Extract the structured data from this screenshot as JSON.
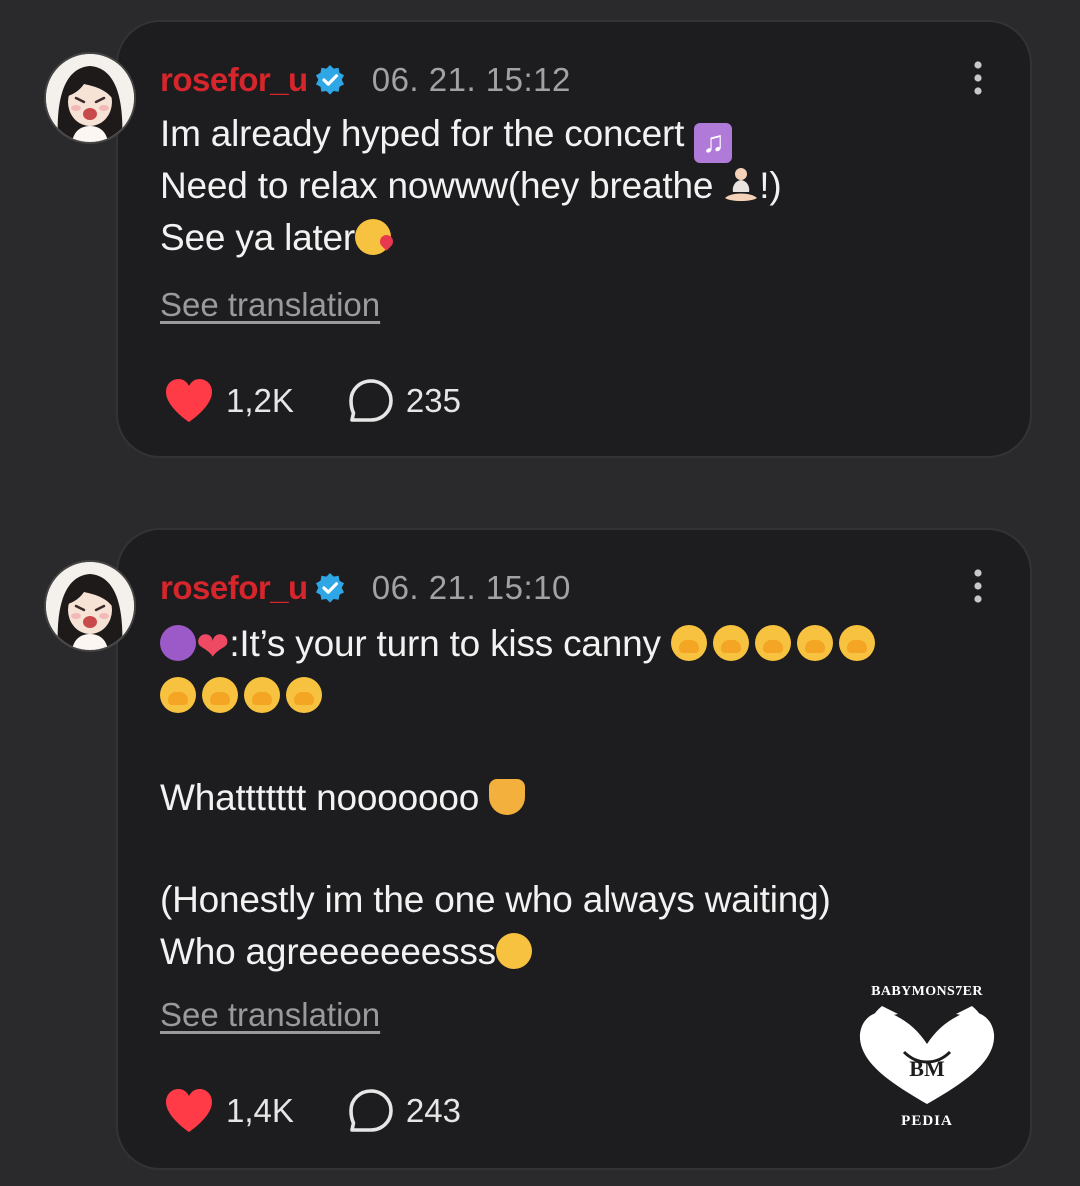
{
  "posts": [
    {
      "username": "rosefor_u",
      "timestamp": "06. 21. 15:12",
      "lines": [
        {
          "text": "Im already hyped for the concert ",
          "emoji": "♫"
        },
        {
          "text": "Need to relax nowww(hey breathe ",
          "emoji": "🧘",
          "after": "!)"
        },
        {
          "text": "See ya later",
          "emoji": "kiss"
        }
      ],
      "translation_link": "See translation",
      "likes": "1,2K",
      "comments": "235"
    },
    {
      "username": "rosefor_u",
      "timestamp": "06. 21. 15:10",
      "line1": ":It’s your turn to kiss canny ",
      "line3": "Whattttttt nooooooo ",
      "line5": "(Honestly im the one who always waiting)",
      "line6": "Who agreeeeeeesss",
      "translation_link": "See translation",
      "likes": "1,4K",
      "comments": "243"
    }
  ],
  "watermark": {
    "top": "BABYMONS7ER",
    "center": "BM",
    "bottom": "PEDIA"
  },
  "colors": {
    "background": "#2a2a2c",
    "card": "#1d1d1f",
    "username": "#d6262c",
    "verified": "#2fa7e6",
    "heart": "#ff3b47"
  },
  "icons": [
    "verified-badge-icon",
    "more-options-icon",
    "heart-icon",
    "comment-icon"
  ]
}
